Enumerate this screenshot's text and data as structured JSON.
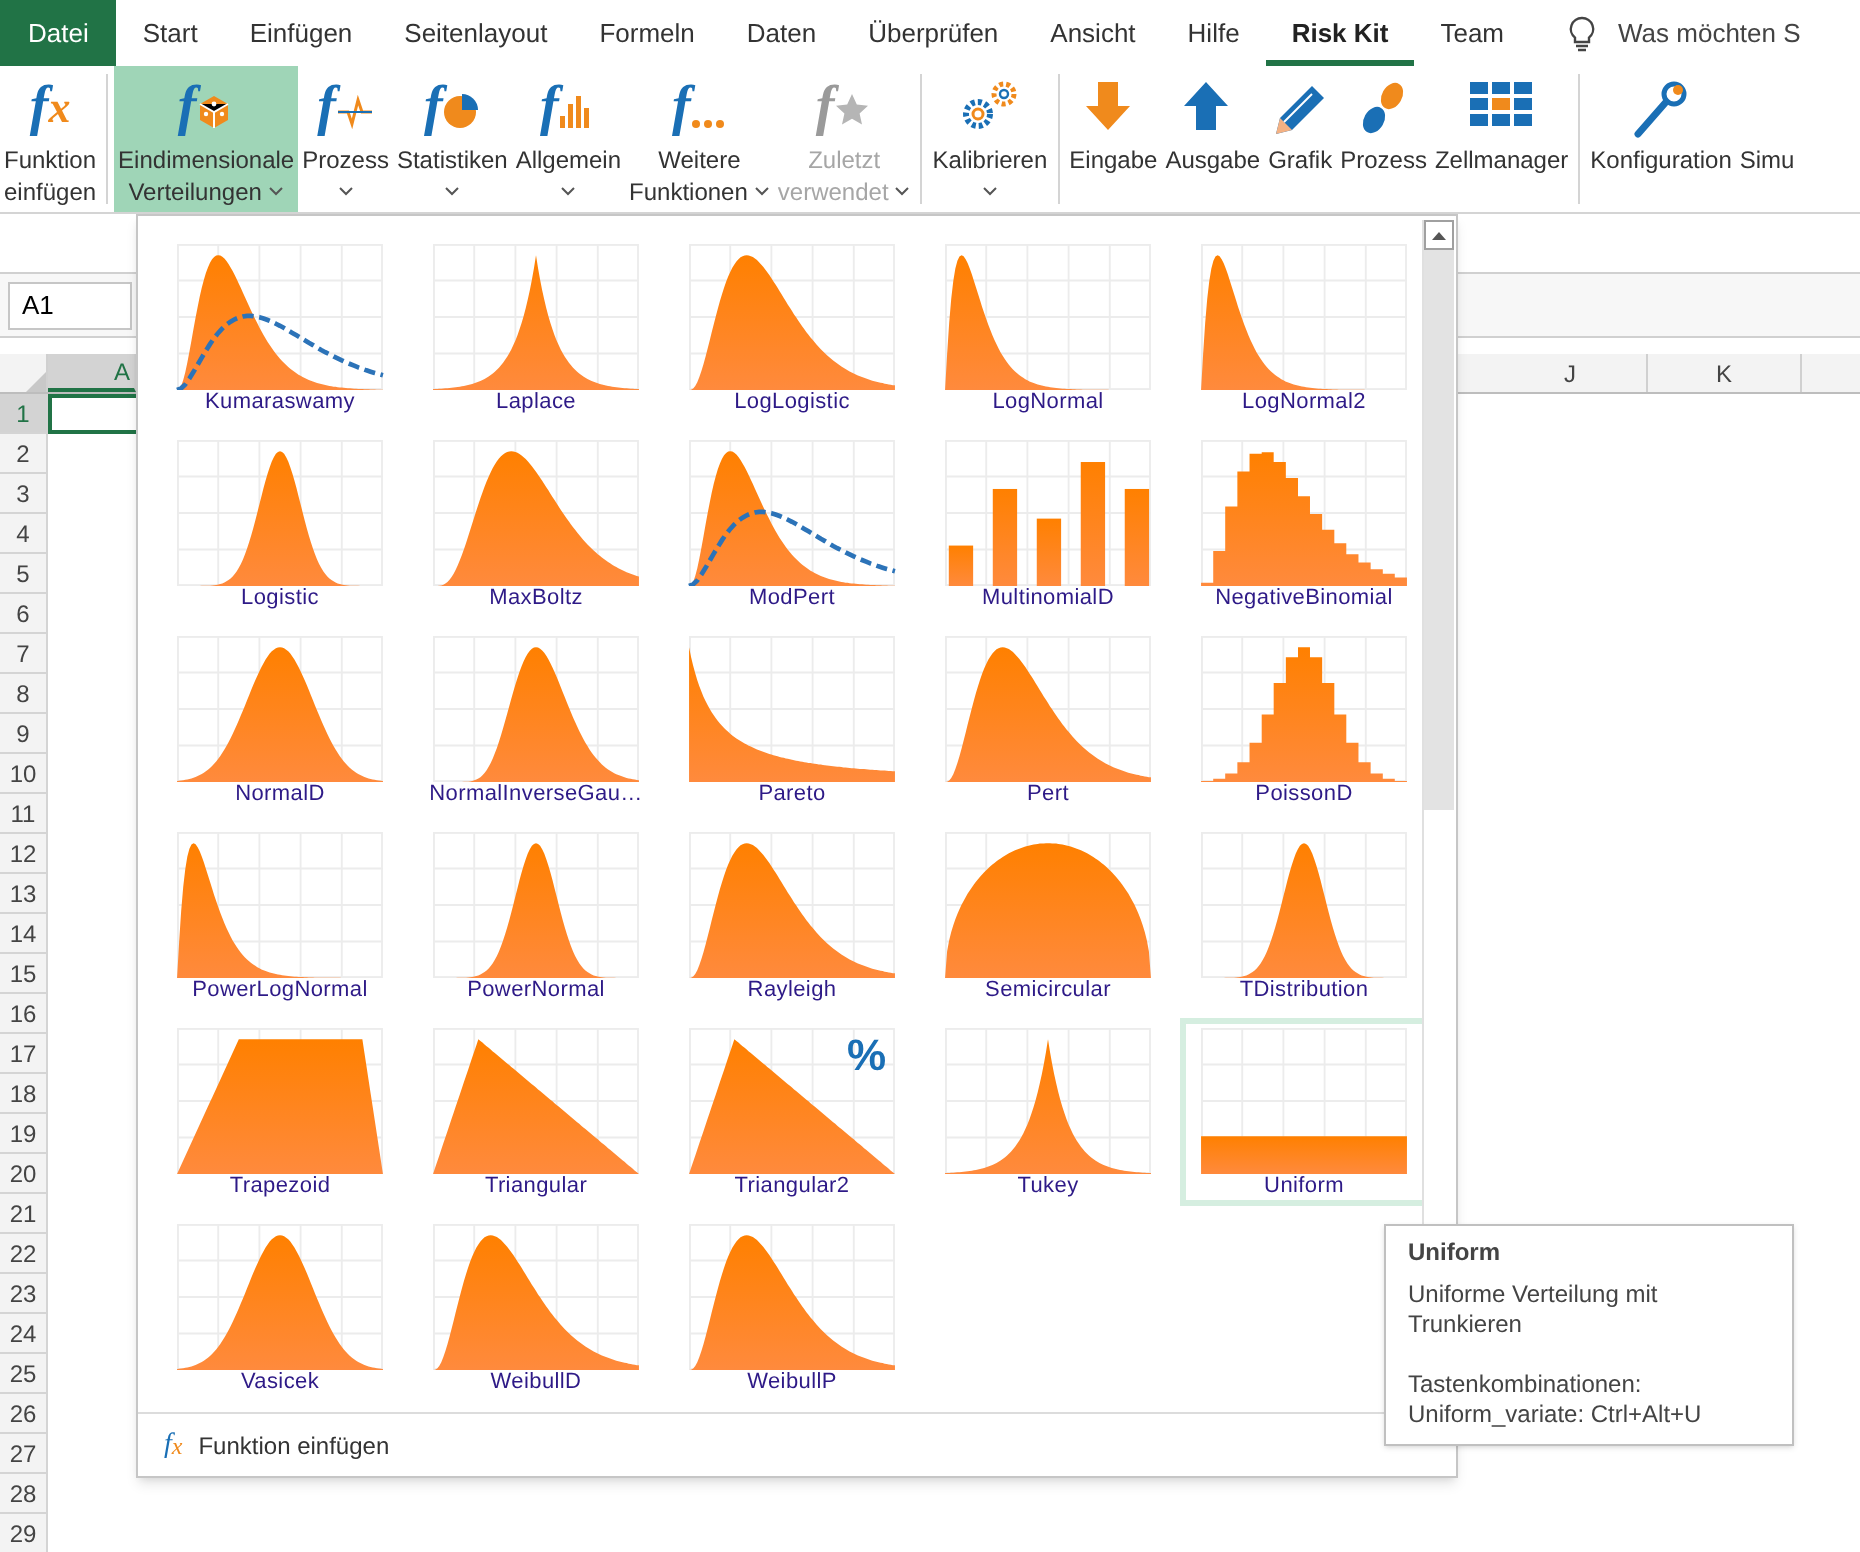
{
  "menu_tabs": [
    {
      "label": "Datei",
      "kind": "file",
      "selected": false
    },
    {
      "label": "Start",
      "kind": "tab",
      "selected": false
    },
    {
      "label": "Einfügen",
      "kind": "tab",
      "selected": false
    },
    {
      "label": "Seitenlayout",
      "kind": "tab",
      "selected": false
    },
    {
      "label": "Formeln",
      "kind": "tab",
      "selected": false
    },
    {
      "label": "Daten",
      "kind": "tab",
      "selected": false
    },
    {
      "label": "Überprüfen",
      "kind": "tab",
      "selected": false
    },
    {
      "label": "Ansicht",
      "kind": "tab",
      "selected": false
    },
    {
      "label": "Hilfe",
      "kind": "tab",
      "selected": false
    },
    {
      "label": "Risk Kit",
      "kind": "tab",
      "selected": true
    },
    {
      "label": "Team",
      "kind": "tab",
      "selected": false
    }
  ],
  "search": {
    "placeholder": "Was möchten S"
  },
  "ribbon": {
    "groups": [
      {
        "buttons": [
          {
            "lines": [
              "Funktion",
              "einfügen"
            ],
            "glyph": "f",
            "glyph2": "x",
            "kind": "none",
            "menu": false,
            "selected": false,
            "disabled": false
          }
        ]
      },
      {
        "buttons": [
          {
            "lines": [
              "Eindimensionale",
              "Verteilungen"
            ],
            "glyph": "f",
            "kind": "dice",
            "menu": true,
            "selected": true,
            "disabled": false
          },
          {
            "lines": [
              "Prozess"
            ],
            "glyph": "f",
            "kind": "wave",
            "menu": true,
            "selected": false,
            "disabled": false
          },
          {
            "lines": [
              "Statistiken"
            ],
            "glyph": "f",
            "kind": "pie",
            "menu": true,
            "selected": false,
            "disabled": false
          },
          {
            "lines": [
              "Allgemein"
            ],
            "glyph": "f",
            "kind": "bars",
            "menu": true,
            "selected": false,
            "disabled": false
          },
          {
            "lines": [
              "Weitere",
              "Funktionen"
            ],
            "glyph": "f",
            "kind": "dots",
            "menu": true,
            "selected": false,
            "disabled": false
          },
          {
            "lines": [
              "Zuletzt",
              "verwendet"
            ],
            "glyph": "f",
            "kind": "star",
            "menu": true,
            "selected": false,
            "disabled": true
          }
        ]
      },
      {
        "buttons": [
          {
            "lines": [
              "Kalibrieren"
            ],
            "kind": "gears",
            "menu": true,
            "selected": false,
            "disabled": false
          }
        ]
      },
      {
        "buttons": [
          {
            "lines": [
              "Eingabe"
            ],
            "kind": "down",
            "menu": false,
            "selected": false,
            "disabled": false
          },
          {
            "lines": [
              "Ausgabe"
            ],
            "kind": "up",
            "menu": false,
            "selected": false,
            "disabled": false
          },
          {
            "lines": [
              "Grafik"
            ],
            "kind": "pencil",
            "menu": false,
            "selected": false,
            "disabled": false
          },
          {
            "lines": [
              "Prozess"
            ],
            "kind": "steps",
            "menu": false,
            "selected": false,
            "disabled": false
          },
          {
            "lines": [
              "Zellmanager"
            ],
            "kind": "grid",
            "menu": false,
            "selected": false,
            "disabled": false
          }
        ]
      },
      {
        "buttons": [
          {
            "lines": [
              "Konfiguration"
            ],
            "kind": "wrench",
            "menu": false,
            "selected": false,
            "disabled": false
          },
          {
            "lines": [
              "Simu"
            ],
            "kind": "none",
            "menu": false,
            "selected": false,
            "disabled": false
          }
        ]
      }
    ]
  },
  "name_box": "A1",
  "columns": [
    {
      "label": "A",
      "selected": true
    },
    {
      "label": "J",
      "selected": false
    },
    {
      "label": "K",
      "selected": false
    }
  ],
  "rows": [
    {
      "label": "1",
      "selected": true
    },
    {
      "label": "2",
      "selected": false
    },
    {
      "label": "3",
      "selected": false
    },
    {
      "label": "4",
      "selected": false
    },
    {
      "label": "5",
      "selected": false
    },
    {
      "label": "6",
      "selected": false
    },
    {
      "label": "7",
      "selected": false
    },
    {
      "label": "8",
      "selected": false
    },
    {
      "label": "9",
      "selected": false
    },
    {
      "label": "10",
      "selected": false
    },
    {
      "label": "11",
      "selected": false
    },
    {
      "label": "12",
      "selected": false
    },
    {
      "label": "13",
      "selected": false
    },
    {
      "label": "14",
      "selected": false
    },
    {
      "label": "15",
      "selected": false
    },
    {
      "label": "16",
      "selected": false
    },
    {
      "label": "17",
      "selected": false
    },
    {
      "label": "18",
      "selected": false
    },
    {
      "label": "19",
      "selected": false
    },
    {
      "label": "20",
      "selected": false
    },
    {
      "label": "21",
      "selected": false
    },
    {
      "label": "22",
      "selected": false
    },
    {
      "label": "23",
      "selected": false
    },
    {
      "label": "24",
      "selected": false
    },
    {
      "label": "25",
      "selected": false
    },
    {
      "label": "26",
      "selected": false
    },
    {
      "label": "27",
      "selected": false
    },
    {
      "label": "28",
      "selected": false
    },
    {
      "label": "29",
      "selected": false
    }
  ],
  "gallery": {
    "items": [
      {
        "label": "Kumaraswamy",
        "kind": "skew-dashed",
        "selected": false
      },
      {
        "label": "Laplace",
        "kind": "peak",
        "selected": false
      },
      {
        "label": "LogLogistic",
        "kind": "skew",
        "selected": false
      },
      {
        "label": "LogNormal",
        "kind": "skew-left",
        "selected": false
      },
      {
        "label": "LogNormal2",
        "kind": "skew-left",
        "selected": false
      },
      {
        "label": "Logistic",
        "kind": "bell-narrow",
        "selected": false
      },
      {
        "label": "MaxBoltz",
        "kind": "skew-wide",
        "selected": false
      },
      {
        "label": "ModPert",
        "kind": "skew-dashed",
        "selected": false
      },
      {
        "label": "MultinomialD",
        "kind": "bars",
        "selected": false
      },
      {
        "label": "NegativeBinomial",
        "kind": "steps-skew",
        "selected": false
      },
      {
        "label": "NormalD",
        "kind": "bell",
        "selected": false
      },
      {
        "label": "NormalInverseGau…",
        "kind": "skew-narrow",
        "selected": false
      },
      {
        "label": "Pareto",
        "kind": "decay",
        "selected": false
      },
      {
        "label": "Pert",
        "kind": "skew",
        "selected": false
      },
      {
        "label": "PoissonD",
        "kind": "steps",
        "selected": false
      },
      {
        "label": "PowerLogNormal",
        "kind": "skew-left",
        "selected": false
      },
      {
        "label": "PowerNormal",
        "kind": "bell-narrow",
        "selected": false
      },
      {
        "label": "Rayleigh",
        "kind": "skew",
        "selected": false
      },
      {
        "label": "Semicircular",
        "kind": "semicircle",
        "selected": false
      },
      {
        "label": "TDistribution",
        "kind": "bell-narrow",
        "selected": false
      },
      {
        "label": "Trapezoid",
        "kind": "trapezoid",
        "selected": false
      },
      {
        "label": "Triangular",
        "kind": "triangle",
        "selected": false
      },
      {
        "label": "Triangular2",
        "kind": "triangle",
        "badge": "%",
        "selected": false
      },
      {
        "label": "Tukey",
        "kind": "peak",
        "selected": false
      },
      {
        "label": "Uniform",
        "kind": "flat",
        "selected": true
      },
      {
        "label": "Vasicek",
        "kind": "bell",
        "selected": false
      },
      {
        "label": "WeibullD",
        "kind": "skew",
        "selected": false
      },
      {
        "label": "WeibullP",
        "kind": "skew",
        "selected": false
      }
    ],
    "footer": {
      "glyph": "f",
      "glyph2": "x",
      "label": "Funktion einfügen"
    }
  },
  "tooltip": {
    "title": "Uniform",
    "description": "Uniforme Verteilung mit Trunkieren",
    "shortcut_heading": "Tastenkombinationen:",
    "shortcut": "Uniform_variate: Ctrl+Alt+U"
  }
}
